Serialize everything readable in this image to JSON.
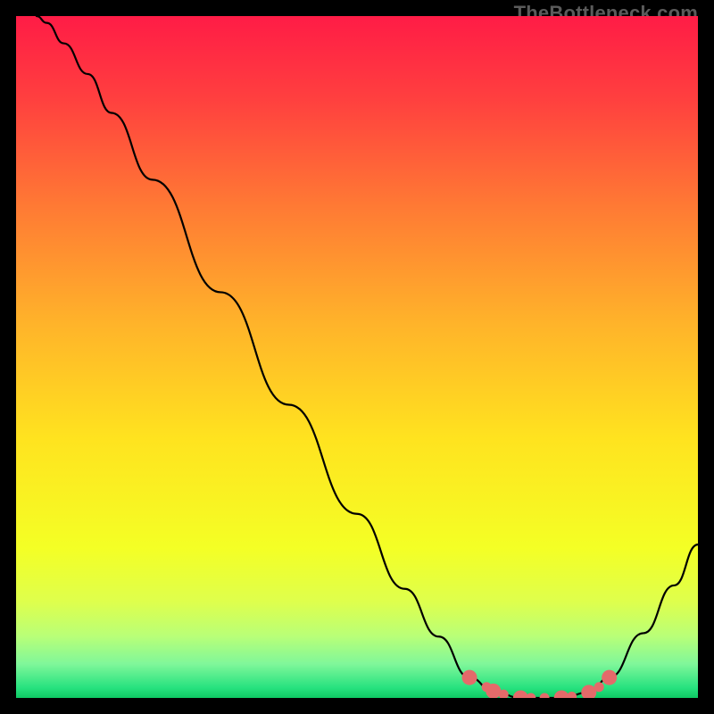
{
  "watermark": "TheBottleneck.com",
  "chart_data": {
    "type": "line",
    "title": "",
    "xlabel": "",
    "ylabel": "",
    "xlim": [
      0,
      1
    ],
    "ylim": [
      0,
      1
    ],
    "background": {
      "type": "vertical-gradient",
      "stops": [
        {
          "offset": 0.0,
          "color": "#ff1c46"
        },
        {
          "offset": 0.12,
          "color": "#ff3f3f"
        },
        {
          "offset": 0.28,
          "color": "#ff7a34"
        },
        {
          "offset": 0.45,
          "color": "#ffb32a"
        },
        {
          "offset": 0.62,
          "color": "#ffe31f"
        },
        {
          "offset": 0.78,
          "color": "#f4ff25"
        },
        {
          "offset": 0.86,
          "color": "#deff4d"
        },
        {
          "offset": 0.91,
          "color": "#b8ff78"
        },
        {
          "offset": 0.95,
          "color": "#80f79a"
        },
        {
          "offset": 0.985,
          "color": "#27e27f"
        },
        {
          "offset": 1.0,
          "color": "#0fc963"
        }
      ]
    },
    "series": [
      {
        "name": "curve",
        "stroke": "#000000",
        "stroke_width": 2.2,
        "points": [
          {
            "x": 0.03,
            "y": 1.0
          },
          {
            "x": 0.045,
            "y": 0.99
          },
          {
            "x": 0.07,
            "y": 0.96
          },
          {
            "x": 0.105,
            "y": 0.915
          },
          {
            "x": 0.14,
            "y": 0.858
          },
          {
            "x": 0.2,
            "y": 0.76
          },
          {
            "x": 0.3,
            "y": 0.595
          },
          {
            "x": 0.4,
            "y": 0.43
          },
          {
            "x": 0.5,
            "y": 0.27
          },
          {
            "x": 0.57,
            "y": 0.16
          },
          {
            "x": 0.62,
            "y": 0.09
          },
          {
            "x": 0.665,
            "y": 0.03
          },
          {
            "x": 0.7,
            "y": 0.01
          },
          {
            "x": 0.74,
            "y": 0.0
          },
          {
            "x": 0.8,
            "y": 0.0
          },
          {
            "x": 0.84,
            "y": 0.008
          },
          {
            "x": 0.87,
            "y": 0.03
          },
          {
            "x": 0.92,
            "y": 0.095
          },
          {
            "x": 0.965,
            "y": 0.165
          },
          {
            "x": 1.0,
            "y": 0.225
          }
        ]
      },
      {
        "name": "highlight-dots",
        "stroke": "none",
        "fill": "#e46a6a",
        "radius": 8.5,
        "points": [
          {
            "x": 0.665,
            "y": 0.03
          },
          {
            "x": 0.7,
            "y": 0.01
          },
          {
            "x": 0.74,
            "y": 0.0
          },
          {
            "x": 0.8,
            "y": 0.0
          },
          {
            "x": 0.84,
            "y": 0.008
          },
          {
            "x": 0.87,
            "y": 0.03
          }
        ]
      },
      {
        "name": "highlight-dots-small",
        "stroke": "none",
        "fill": "#e46a6a",
        "radius": 5.5,
        "points": [
          {
            "x": 0.69,
            "y": 0.016
          },
          {
            "x": 0.715,
            "y": 0.005
          },
          {
            "x": 0.755,
            "y": 0.0
          },
          {
            "x": 0.775,
            "y": 0.0
          },
          {
            "x": 0.815,
            "y": 0.002
          },
          {
            "x": 0.855,
            "y": 0.016
          }
        ]
      }
    ]
  }
}
